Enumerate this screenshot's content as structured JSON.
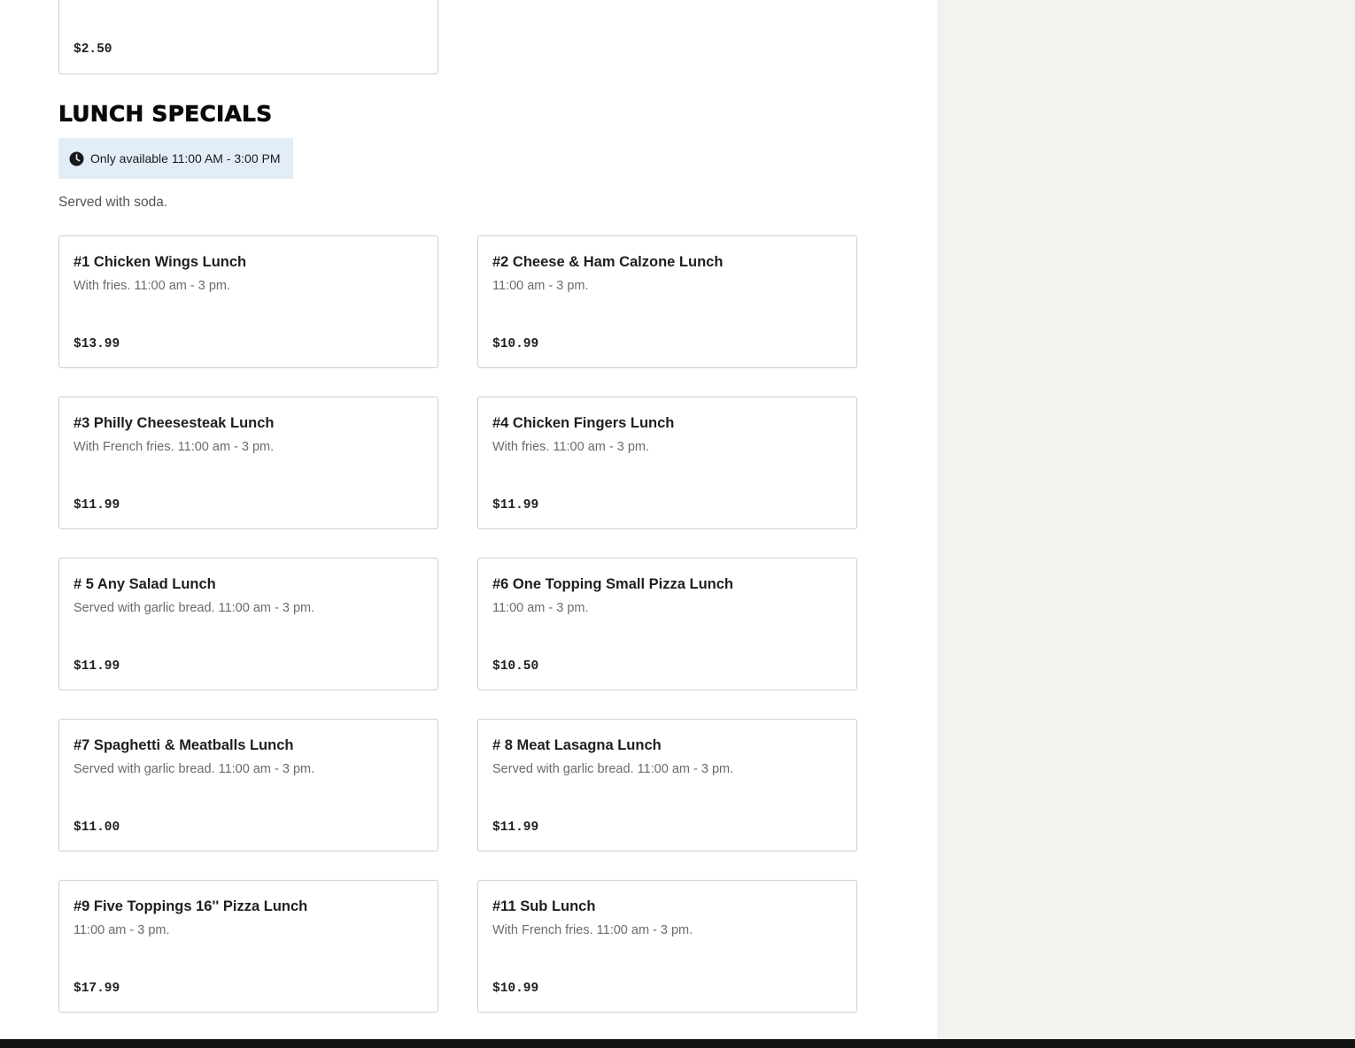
{
  "previous_item": {
    "price": "$2.50"
  },
  "section": {
    "title": "LUNCH SPECIALS",
    "availability": "Only available 11:00 AM - 3:00 PM",
    "availability_icon": "clock-icon",
    "note": "Served with soda."
  },
  "items": [
    {
      "name": "#1 Chicken Wings Lunch",
      "desc": "With fries. 11:00 am - 3 pm.",
      "price": "$13.99"
    },
    {
      "name": "#2 Cheese & Ham Calzone Lunch",
      "desc": "11:00 am - 3 pm.",
      "price": "$10.99"
    },
    {
      "name": "#3 Philly Cheesesteak Lunch",
      "desc": "With French fries. 11:00 am - 3 pm.",
      "price": "$11.99"
    },
    {
      "name": "#4 Chicken Fingers Lunch",
      "desc": "With fries. 11:00 am - 3 pm.",
      "price": "$11.99"
    },
    {
      "name": "# 5 Any Salad Lunch",
      "desc": "Served with garlic bread. 11:00 am - 3 pm.",
      "price": "$11.99"
    },
    {
      "name": "#6 One Topping Small Pizza Lunch",
      "desc": "11:00 am - 3 pm.",
      "price": "$10.50"
    },
    {
      "name": "#7 Spaghetti & Meatballs Lunch",
      "desc": "Served with garlic bread. 11:00 am - 3 pm.",
      "price": "$11.00"
    },
    {
      "name": "# 8 Meat Lasagna Lunch",
      "desc": "Served with garlic bread. 11:00 am - 3 pm.",
      "price": "$11.99"
    },
    {
      "name": "#9 Five Toppings 16'' Pizza Lunch",
      "desc": "11:00 am - 3 pm.",
      "price": "$17.99"
    },
    {
      "name": "#11 Sub Lunch",
      "desc": "With French fries. 11:00 am - 3 pm.",
      "price": "$10.99"
    }
  ],
  "colors": {
    "availability_bg": "#e3edf8",
    "sidebar_bg": "#f3f2ef",
    "card_border": "#cfcfcf",
    "footer_bar": "#111111"
  }
}
